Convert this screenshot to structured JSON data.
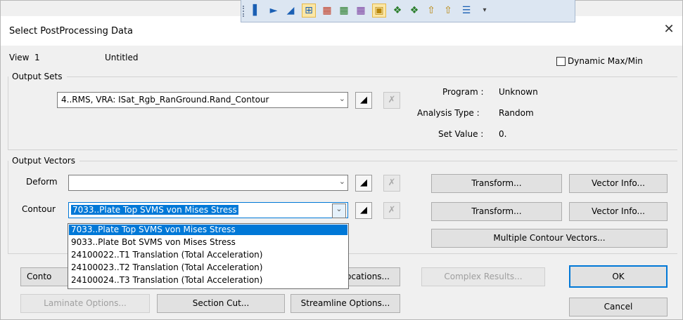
{
  "dialog": {
    "title": "Select PostProcessing Data",
    "close_glyph": "✕"
  },
  "toolbar": {
    "icons": [
      "bar-chart-icon",
      "bar-chart-icon",
      "bar-chart-icon",
      "grid-icon",
      "color-grid-icon",
      "color-grid-icon",
      "color-grid-icon",
      "pick-icon",
      "model-icon",
      "model-icon",
      "arrow-icon",
      "arrow-icon",
      "list-icon",
      "overflow-icon"
    ]
  },
  "view": {
    "label": "View",
    "number": "1",
    "name": "Untitled"
  },
  "dynamic_max_min": {
    "label": "Dynamic Max/Min",
    "checked": false
  },
  "output_sets": {
    "group_label": "Output Sets",
    "selected": "4..RMS, VRA: ISat_Rgb_RanGround.Rand_Contour",
    "program_label": "Program :",
    "program_value": "Unknown",
    "analysis_label": "Analysis Type :",
    "analysis_value": "Random",
    "set_value_label": "Set Value :",
    "set_value_value": "0."
  },
  "output_vectors": {
    "group_label": "Output Vectors",
    "deform_label": "Deform",
    "deform_value": "",
    "contour_label": "Contour",
    "contour_value": "7033..Plate Top SVMS von Mises Stress",
    "contour_options": [
      "7033..Plate Top SVMS von Mises Stress",
      "9033..Plate Bot SVMS von Mises Stress",
      "24100022..T1 Translation (Total Acceleration)",
      "24100023..T2 Translation (Total Acceleration)",
      "24100024..T3 Translation (Total Acceleration)"
    ],
    "transform_label": "Transform...",
    "vector_info_label": "Vector Info...",
    "multiple_contour_label": "Multiple Contour Vectors..."
  },
  "bottom_buttons": {
    "contour_partial": "Conto",
    "locations_partial": "ocations...",
    "complex_results": "Complex Results...",
    "ok": "OK",
    "laminate_options": "Laminate Options...",
    "section_cut": "Section Cut...",
    "streamline_options": "Streamline Options...",
    "cancel": "Cancel"
  }
}
